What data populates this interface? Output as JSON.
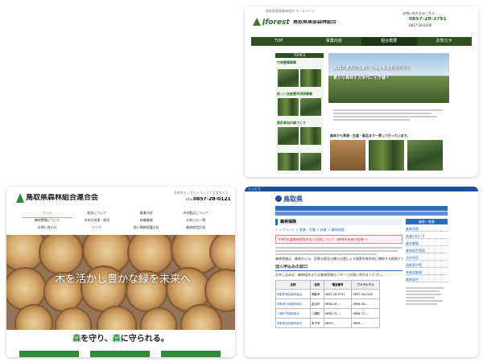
{
  "card1": {
    "top_note": "鳥取県東部森林組合 ホームページ",
    "logo": "Jforest",
    "org_name": "鳥取県東部森林組合",
    "contact_note": "お問い合わせはこちら",
    "tel": "0857-28-3751",
    "fax": "0857-28-0100",
    "nav": [
      "TOP",
      "事業内容",
      "組合概要",
      "お知らせ"
    ],
    "side_header": "TOPICS",
    "side_items": [
      "竹林整備事業",
      "松くい虫被害木伐倒事業",
      "県民参加の森づくり"
    ],
    "hero_line1": "森林の恵みに感謝し、地域資源を活かせる",
    "hero_line2": "豊かな森林を次世代に引き継ぐ",
    "body_lead": "森林から資源・生産・製品まで一貫して行っています。"
  },
  "card2": {
    "org_name": "鳥取県森林組合連合会",
    "top_links": "お問合せ | サイトマップ | 文字サイズ",
    "tel_label": "TEL.",
    "tel": "0857-28-0121",
    "nav_row1": [
      "ホーム",
      "組合について",
      "事業内容",
      "木材製品について"
    ],
    "nav_row2": [
      "森林整備について",
      "木材の流通・販売",
      "林業機械",
      "お知らせ一覧"
    ],
    "nav_row3": [
      "お問い合わせ",
      "リンク",
      "個人情報保護方針",
      "森林経営計画"
    ],
    "hero_text": "木を活かし豊かな緑を未来へ",
    "slogan_pre": "森",
    "slogan_mid1": "を守り、",
    "slogan_mid2": "森",
    "slogan_post": "に守られる。"
  },
  "card3": {
    "header_tag": "とっとり",
    "org_name": "鳥取県",
    "page_title": "森林保険",
    "breadcrumb": "トップページ > 産業・労働 > 林業 > 森林保険",
    "notice": "令和5年度森林保険の加入促進について（森林所有者の皆様へ）",
    "body": "森林保険は、森林の火災、気象災害及び噴火災害による損害を総合的に補償する保険です。",
    "section": "加入申込みの窓口",
    "section_intro": "お申し込みは、森林組合または森林保険センターへお問い合わせください。",
    "table_headers": [
      "名称",
      "住所",
      "電話番号",
      "ファクシミリ"
    ],
    "table_rows": [
      [
        "鳥取県東部森林組合",
        "鳥取市",
        "0857-28-3751",
        "0857-28-0100"
      ],
      [
        "鳥取県中部森林組合",
        "倉吉市",
        "0858-26-...",
        "0858-26-..."
      ],
      [
        "八頭中央森林組合",
        "八頭町",
        "0858-72-...",
        "0858-72-..."
      ],
      [
        "鳥取県西部森林組合",
        "米子市",
        "0859-...",
        "0859-..."
      ]
    ],
    "side_title": "森林・林業",
    "side_links": [
      "森林保険",
      "林業の担い手",
      "森林整備",
      "森林経営管理",
      "木材利用",
      "鳥獣害対策",
      "林業試験場",
      "森林組合"
    ]
  }
}
